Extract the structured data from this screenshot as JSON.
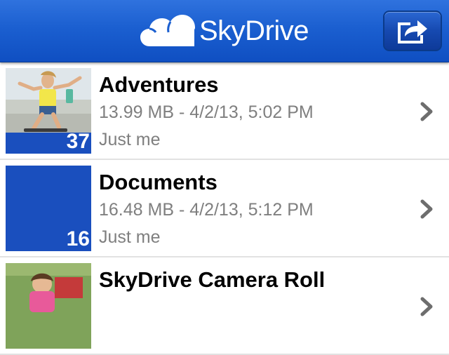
{
  "header": {
    "app_name": "SkyDrive",
    "logo_icon": "cloud-icon",
    "share_icon": "share-icon",
    "brand_color": "#1b5fd0"
  },
  "folders": [
    {
      "name": "Adventures",
      "details": "13.99 MB - 4/2/13, 5:02 PM",
      "sharing": "Just me",
      "count": "37",
      "thumbnail": "photo of skateboarder"
    },
    {
      "name": "Documents",
      "details": "16.48 MB - 4/2/13, 5:12 PM",
      "sharing": "Just me",
      "count": "16",
      "thumbnail": "blue folder tile"
    },
    {
      "name": "SkyDrive Camera Roll",
      "thumbnail": "photo of child on blanket"
    }
  ]
}
